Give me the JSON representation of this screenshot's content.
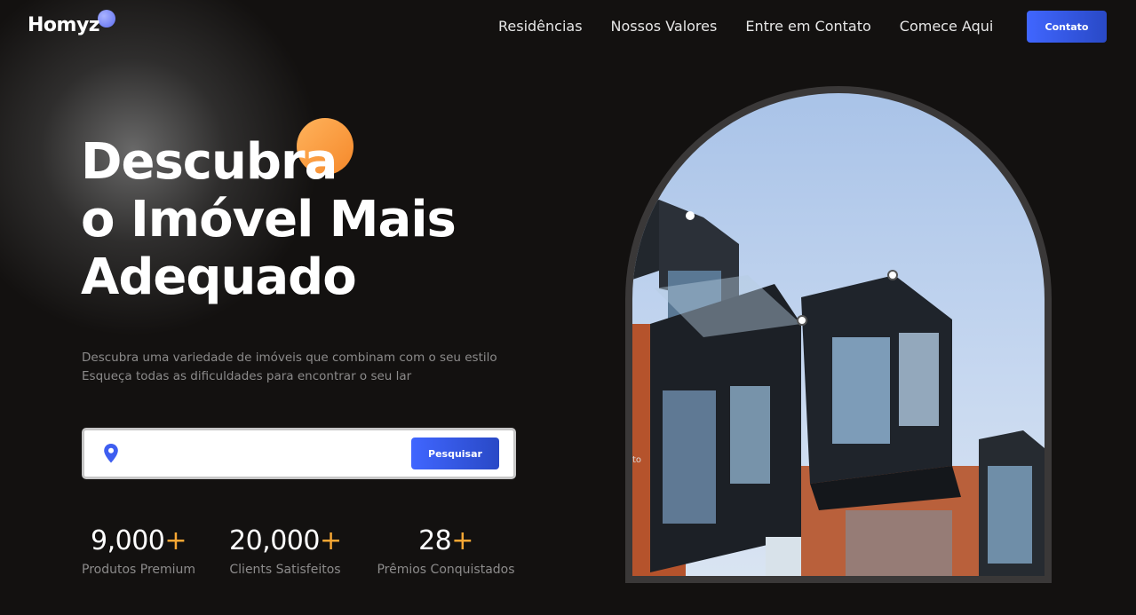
{
  "header": {
    "logo": "Homyz",
    "nav": [
      "Residências",
      "Nossos Valores",
      "Entre em Contato",
      "Comece Aqui"
    ],
    "contact_button": "Contato"
  },
  "hero": {
    "title_lines": [
      "Descubra",
      "o Imóvel Mais",
      "Adequado"
    ],
    "subtitle_lines": [
      "Descubra uma variedade de imóveis que combinam com o seu estilo",
      "Esqueça todas as dificuldades para encontrar o seu lar"
    ],
    "search": {
      "placeholder": "",
      "value": "",
      "button": "Pesquisar"
    },
    "stats": [
      {
        "value": "9,000",
        "suffix": "+",
        "label": "Produtos Premium"
      },
      {
        "value": "20,000",
        "suffix": "+",
        "label": "Clients Satisfeitos"
      },
      {
        "value": "28",
        "suffix": "+",
        "label": "Prêmios Conquistados"
      }
    ],
    "image_caption_fragment": "to"
  },
  "colors": {
    "background": "#131110",
    "accent_blue": "#4066ff",
    "accent_orange": "#f7a734",
    "muted_text": "#8c8b8b"
  },
  "icons": [
    "location-pin-icon"
  ]
}
